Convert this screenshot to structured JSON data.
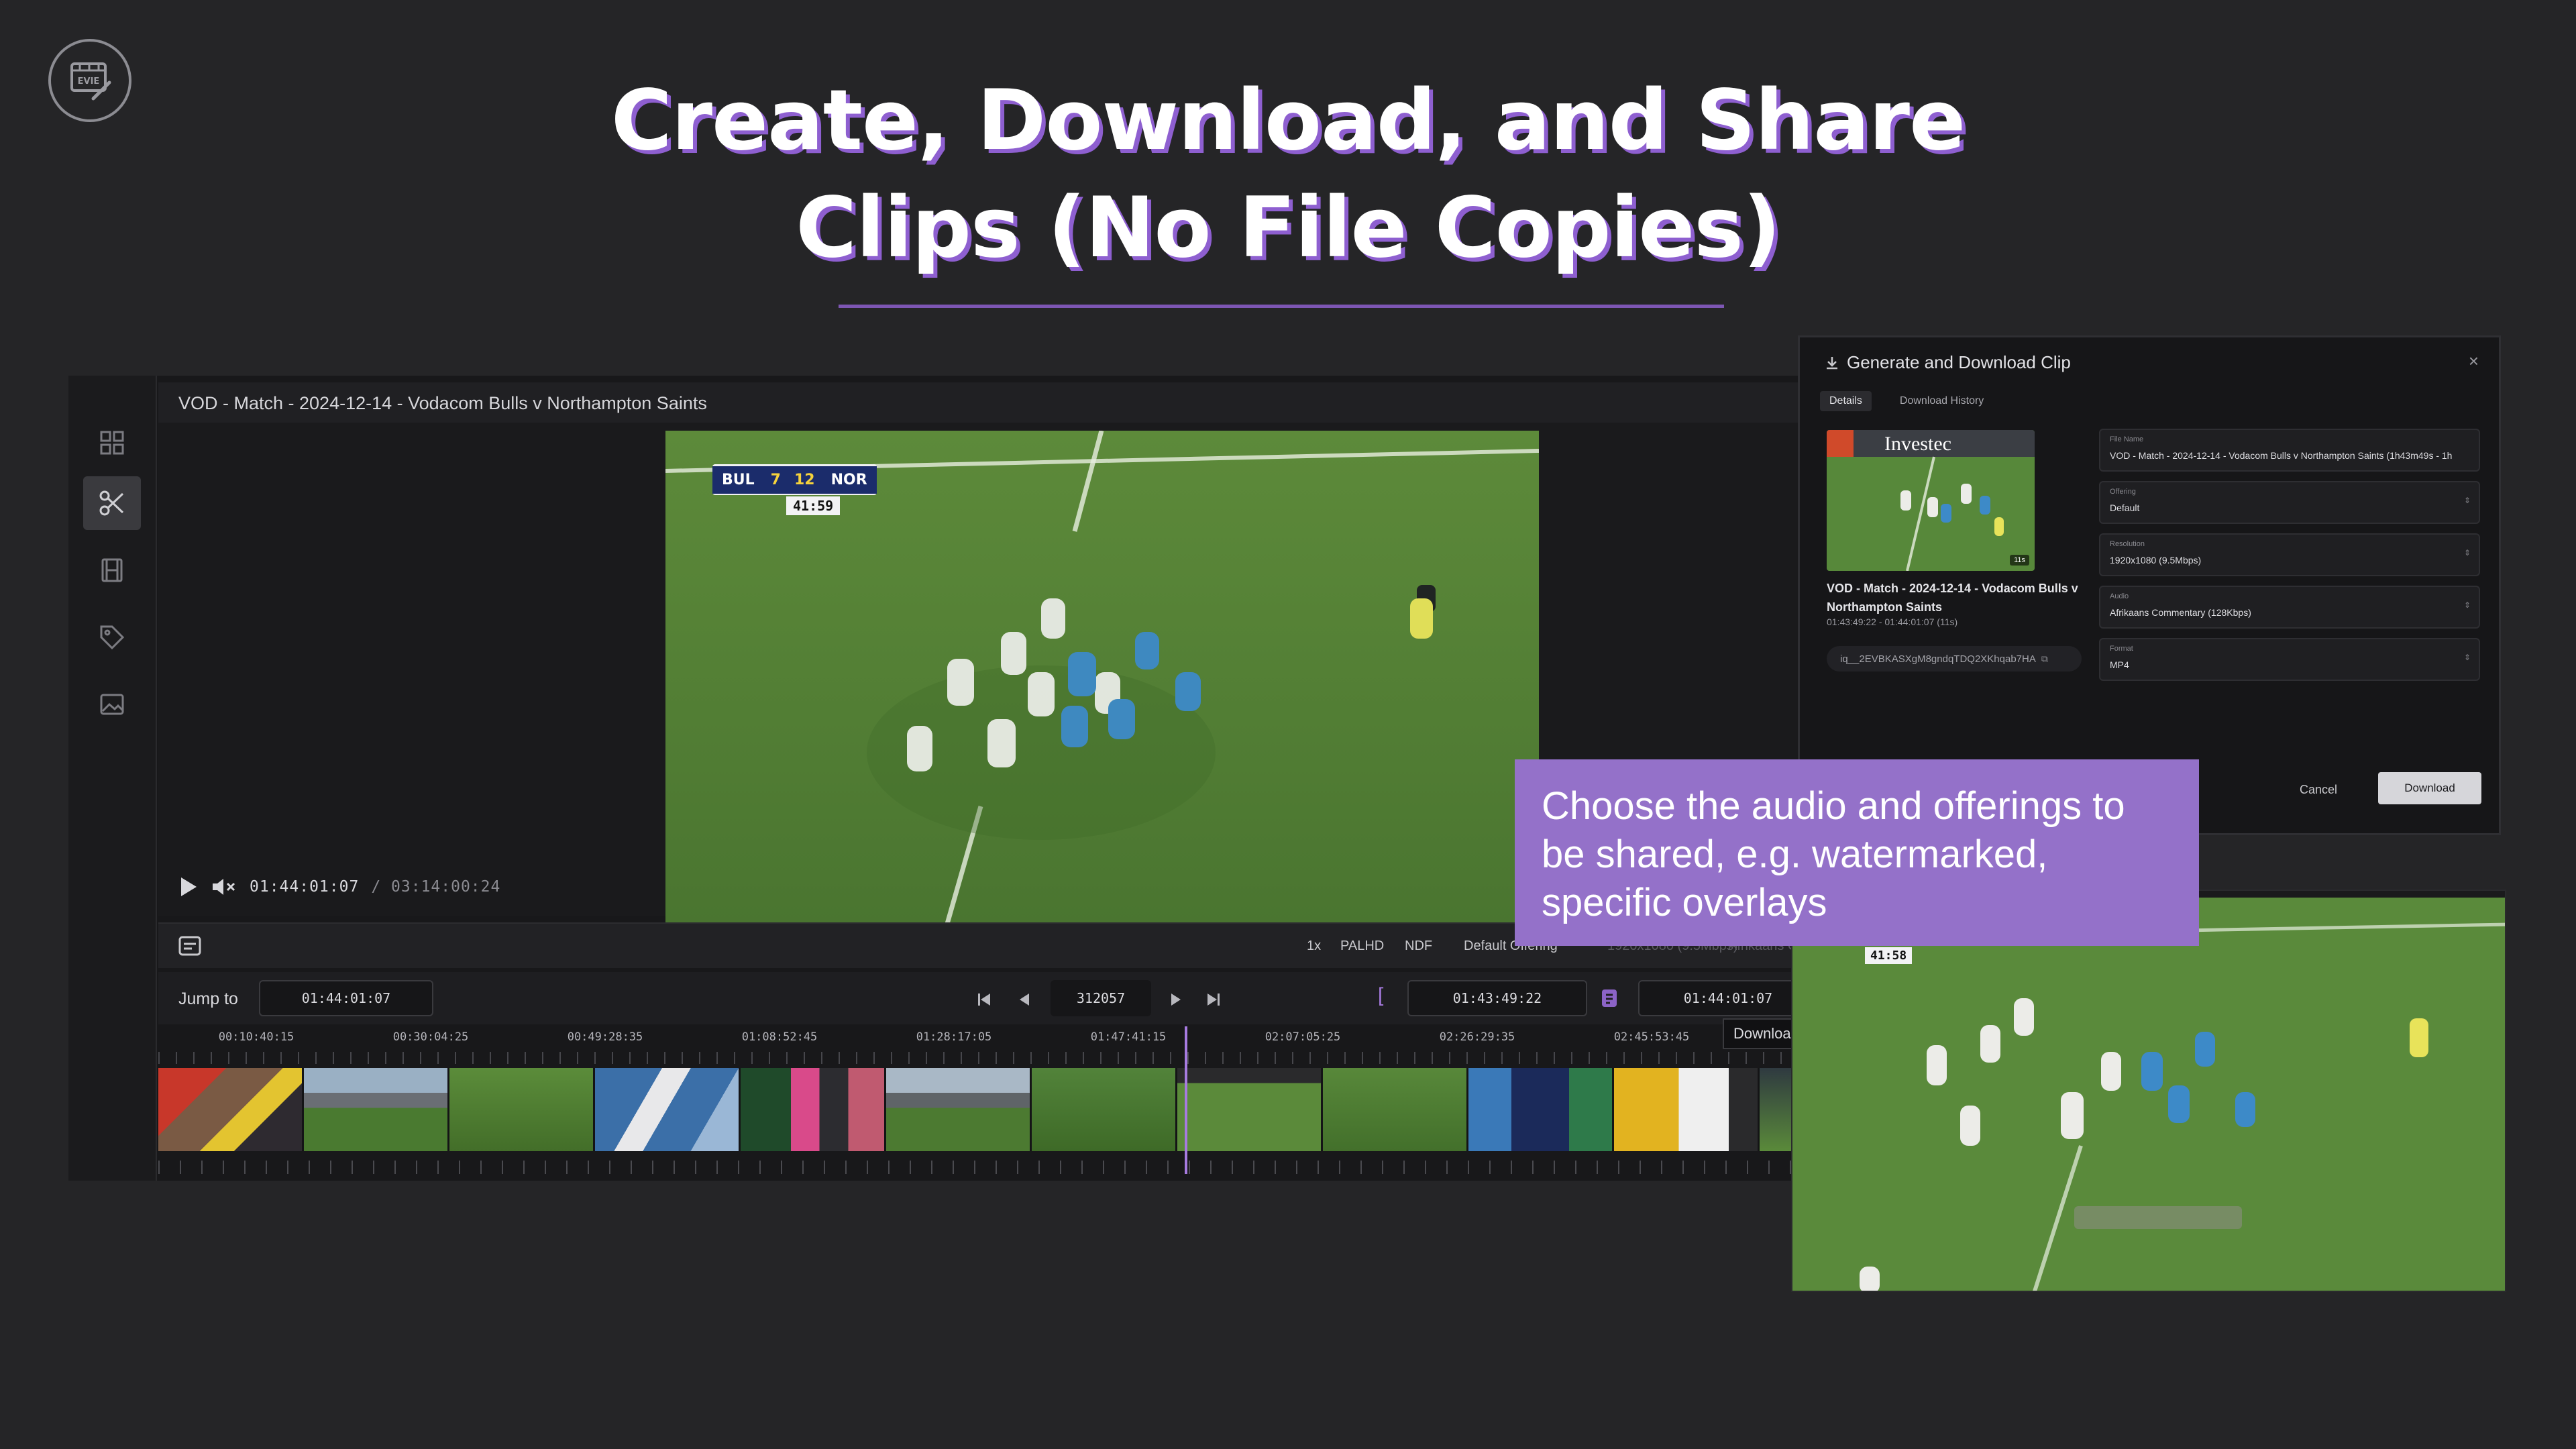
{
  "headline": {
    "line1": "Create, Download, and Share",
    "line2": "Clips (No File Copies)"
  },
  "logo": {
    "text": "EVIE",
    "icon": "film-pen-icon"
  },
  "editor": {
    "sidebar": [
      "grid-icon",
      "scissors-icon",
      "film-icon",
      "tag-icon",
      "image-icon"
    ],
    "video_title": "VOD - Match - 2024-12-14 - Vodacom Bulls v Northampton Saints",
    "scoreboard": {
      "home": "BUL",
      "home_score": "7",
      "away_score": "12",
      "away": "NOR",
      "clock": "41:59"
    },
    "current_time": "01:44:01:07",
    "duration": "/ 03:14:00:24",
    "options": {
      "speed": "1x",
      "format": "PALHD",
      "timecode": "NDF",
      "offering": "Default Offering",
      "resolution": "1920x1080 (9.5Mbps)",
      "audio": "Afrikaans C"
    },
    "jump_label": "Jump to",
    "jump_value": "01:44:01:07",
    "frame_value": "312057",
    "in_point": "01:43:49:22",
    "out_point": "01:44:01:07",
    "in_bracket": "[",
    "out_bracket": "]",
    "ruler_labels": [
      "00:10:40:15",
      "00:30:04:25",
      "00:49:28:35",
      "01:08:52:45",
      "01:28:17:05",
      "01:47:41:15",
      "02:07:05:25",
      "02:26:29:35",
      "02:45:53:45"
    ],
    "download_tooltip": "Downloa"
  },
  "dialog": {
    "title": "Generate and Download Clip",
    "close": "×",
    "tabs": [
      "Details",
      "Download History"
    ],
    "thumb_brand": "Investec",
    "thumb_badge": "11s",
    "clip_name": "VOD - Match - 2024-12-14 - Vodacom Bulls v Northampton Saints",
    "clip_range": "01:43:49:22 - 01:44:01:07 (11s)",
    "clip_id": "iq__2EVBKASXgM8gndqTDQ2XKhqab7HA",
    "fields": [
      {
        "label": "File Name",
        "value": "VOD - Match - 2024-12-14 - Vodacom Bulls v Northampton Saints (1h43m49s - 1h"
      },
      {
        "label": "Offering",
        "value": "Default"
      },
      {
        "label": "Resolution",
        "value": "1920x1080 (9.5Mbps)"
      },
      {
        "label": "Audio",
        "value": "Afrikaans Commentary (128Kbps)"
      },
      {
        "label": "Format",
        "value": "MP4"
      }
    ],
    "cancel": "Cancel",
    "download": "Download"
  },
  "callout": "Choose the audio and offerings to be shared, e.g. watermarked, specific overlays",
  "video2": {
    "clock": "41:58"
  },
  "colors": {
    "accent": "#9471c9",
    "background": "#252527",
    "pitch": "#4f7a33"
  }
}
